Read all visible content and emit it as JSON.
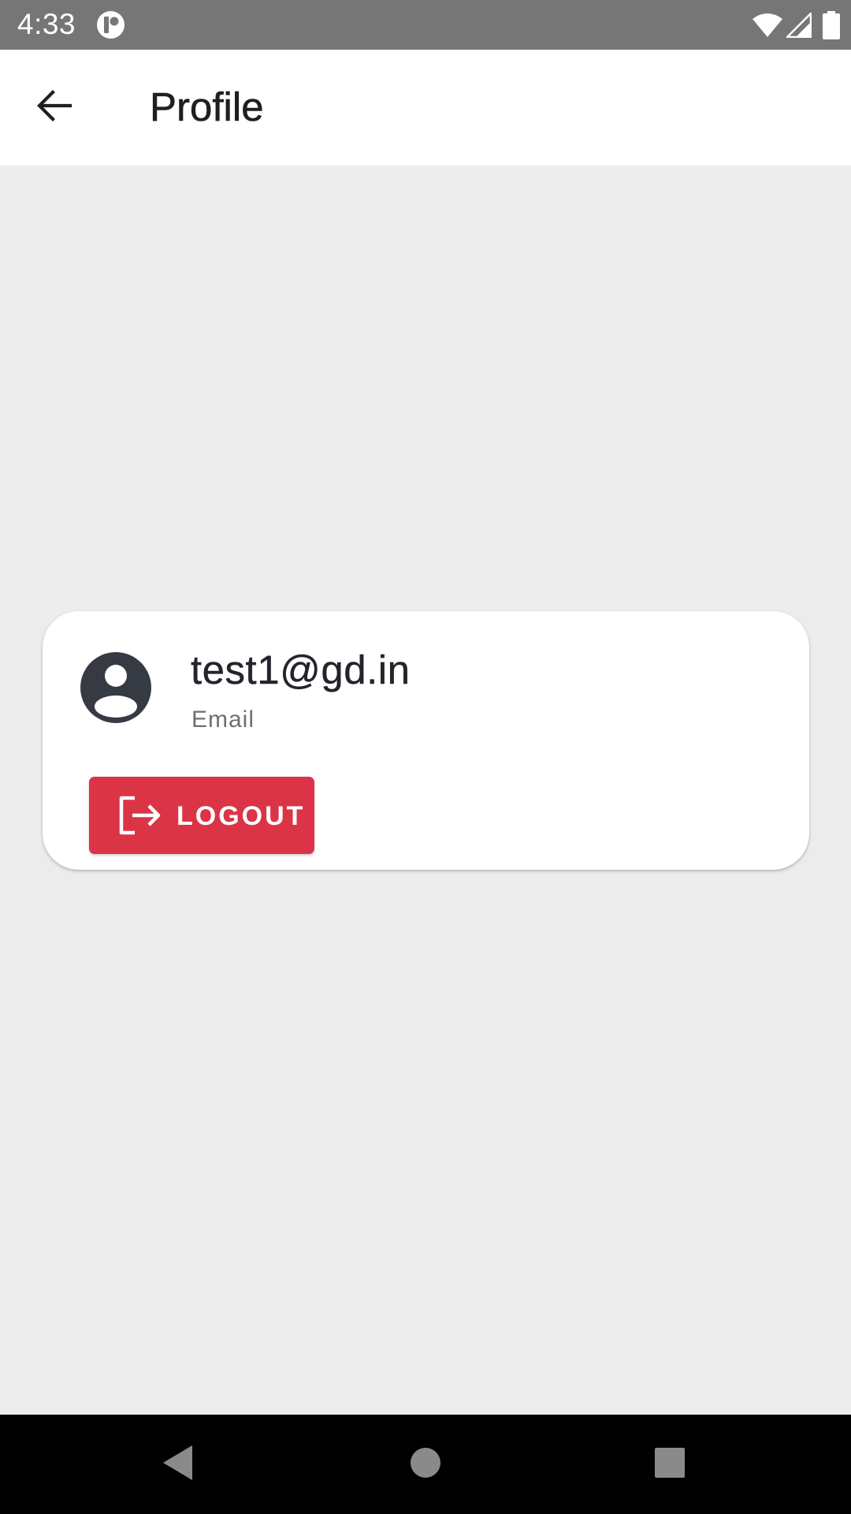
{
  "status_bar": {
    "time": "4:33"
  },
  "app_bar": {
    "title": "Profile"
  },
  "profile": {
    "email": "test1@gd.in",
    "email_label": "Email"
  },
  "logout": {
    "label": "LOGOUT"
  },
  "colors": {
    "status_bar_bg": "#767676",
    "app_bar_bg": "#ffffff",
    "screen_bg": "#ececec",
    "avatar": "#363a43",
    "logout_bg": "#dc3447",
    "nav_bar_bg": "#000000"
  },
  "icons": {
    "back": "arrow-back-icon",
    "avatar": "account-circle-icon",
    "logout": "logout-icon",
    "wifi": "wifi-icon",
    "signal": "signal-icon",
    "battery": "battery-icon",
    "status_app": "notification-app-icon",
    "nav_back": "nav-back-icon",
    "nav_home": "nav-home-icon",
    "nav_recents": "nav-recents-icon"
  }
}
